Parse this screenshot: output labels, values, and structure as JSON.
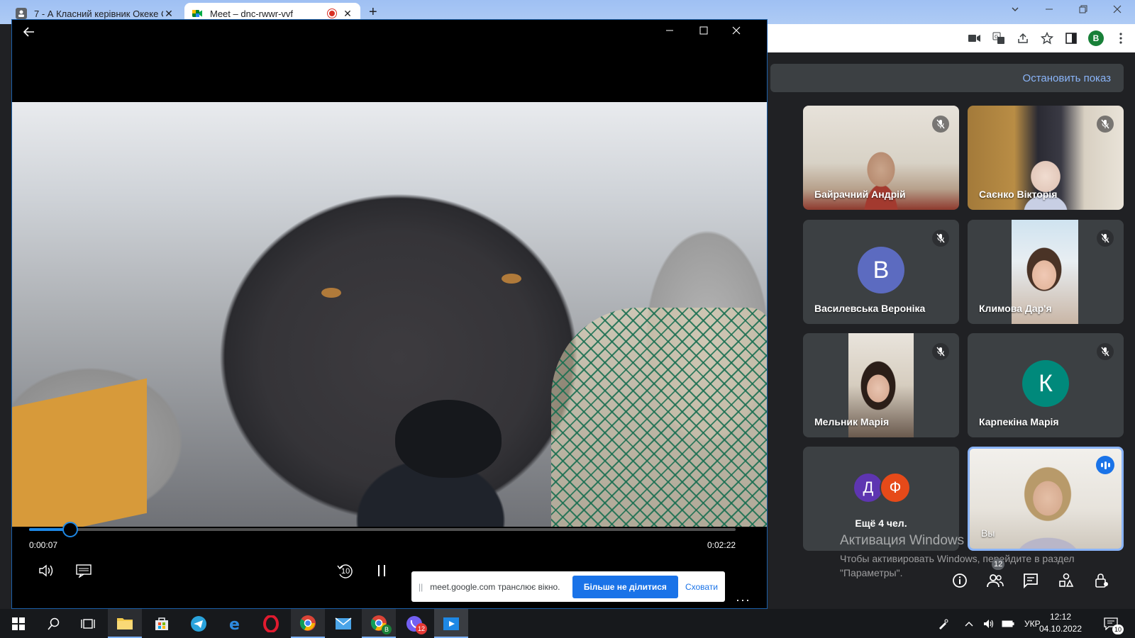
{
  "browser": {
    "tabs": [
      {
        "title": "7 - А Класний керівник Океке С",
        "close": "✕"
      },
      {
        "title": "Meet – dnc-rwwr-vvf",
        "close": "✕"
      }
    ],
    "new_tab": "+",
    "profile_initial": "B"
  },
  "meet": {
    "stop_show": "Остановить показ",
    "participants": [
      {
        "name": "Байрачний Андрій",
        "muted": true
      },
      {
        "name": "Саєнко Вікторія",
        "muted": true
      },
      {
        "name": "Василевська Вероніка",
        "initial": "В",
        "color": "#5c6bc0",
        "muted": true
      },
      {
        "name": "Климова Дар'я",
        "muted": true
      },
      {
        "name": "Мельник Марія",
        "muted": true
      },
      {
        "name": "Карпекіна Марія",
        "initial": "К",
        "color": "#00897b",
        "muted": true
      }
    ],
    "more": {
      "initials": [
        "Д",
        "Ф"
      ],
      "colors": [
        "#5e35b1",
        "#e64a19"
      ],
      "label": "Ещё 4 чел."
    },
    "self": {
      "name": "Вы"
    },
    "people_count": "12",
    "activation": {
      "title": "Активация Windows",
      "line1": "Чтобы активировать Windows, перейдите в раздел",
      "line2": "\"Параметры\"."
    }
  },
  "player": {
    "current_time": "0:00:07",
    "duration": "0:02:22",
    "progress": 0.058,
    "skip_back": "10",
    "share_bar": {
      "message": "meet.google.com транслює вікно.",
      "stop_button": "Більше не ділитися",
      "hide_button": "Сховати"
    },
    "more": "···"
  },
  "taskbar": {
    "chrome_badge": "B",
    "viber_badge": "12",
    "language": "УКР",
    "time": "12:12",
    "date": "04.10.2022",
    "notifications": "10"
  }
}
